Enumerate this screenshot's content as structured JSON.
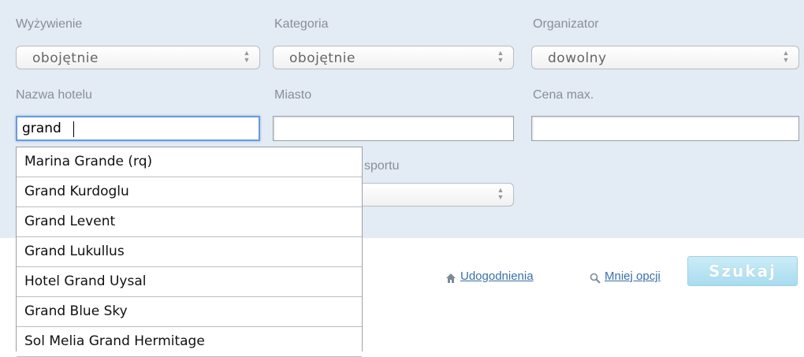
{
  "filters": {
    "meal": {
      "label": "Wyżywienie",
      "value": "obojętnie"
    },
    "category": {
      "label": "Kategoria",
      "value": "obojętnie"
    },
    "organizer": {
      "label": "Organizator",
      "value": "dowolny"
    },
    "hotel_name": {
      "label": "Nazwa hotelu",
      "value": "grand"
    },
    "city": {
      "label": "Miasto",
      "value": ""
    },
    "max_price": {
      "label": "Cena max.",
      "value": ""
    },
    "transport": {
      "label_partial": "sportu"
    }
  },
  "actions": {
    "amenities_link": "Udogodnienia",
    "fewer_options_link": "Mniej opcji",
    "search_button": "Szukaj"
  },
  "autocomplete": [
    "Marina Grande (rq)",
    "Grand Kurdoglu",
    "Grand Levent",
    "Grand Lukullus",
    "Hotel Grand Uysal",
    "Grand Blue Sky",
    "Sol Melia Grand Hermitage"
  ],
  "icons": {
    "home": "home-icon",
    "search": "search-icon",
    "select_arrows": "updown-arrows-icon"
  },
  "colors": {
    "panel_bg": "#e3ebf5",
    "link": "#3a6fa8",
    "button_bg": "#a9dcef"
  }
}
